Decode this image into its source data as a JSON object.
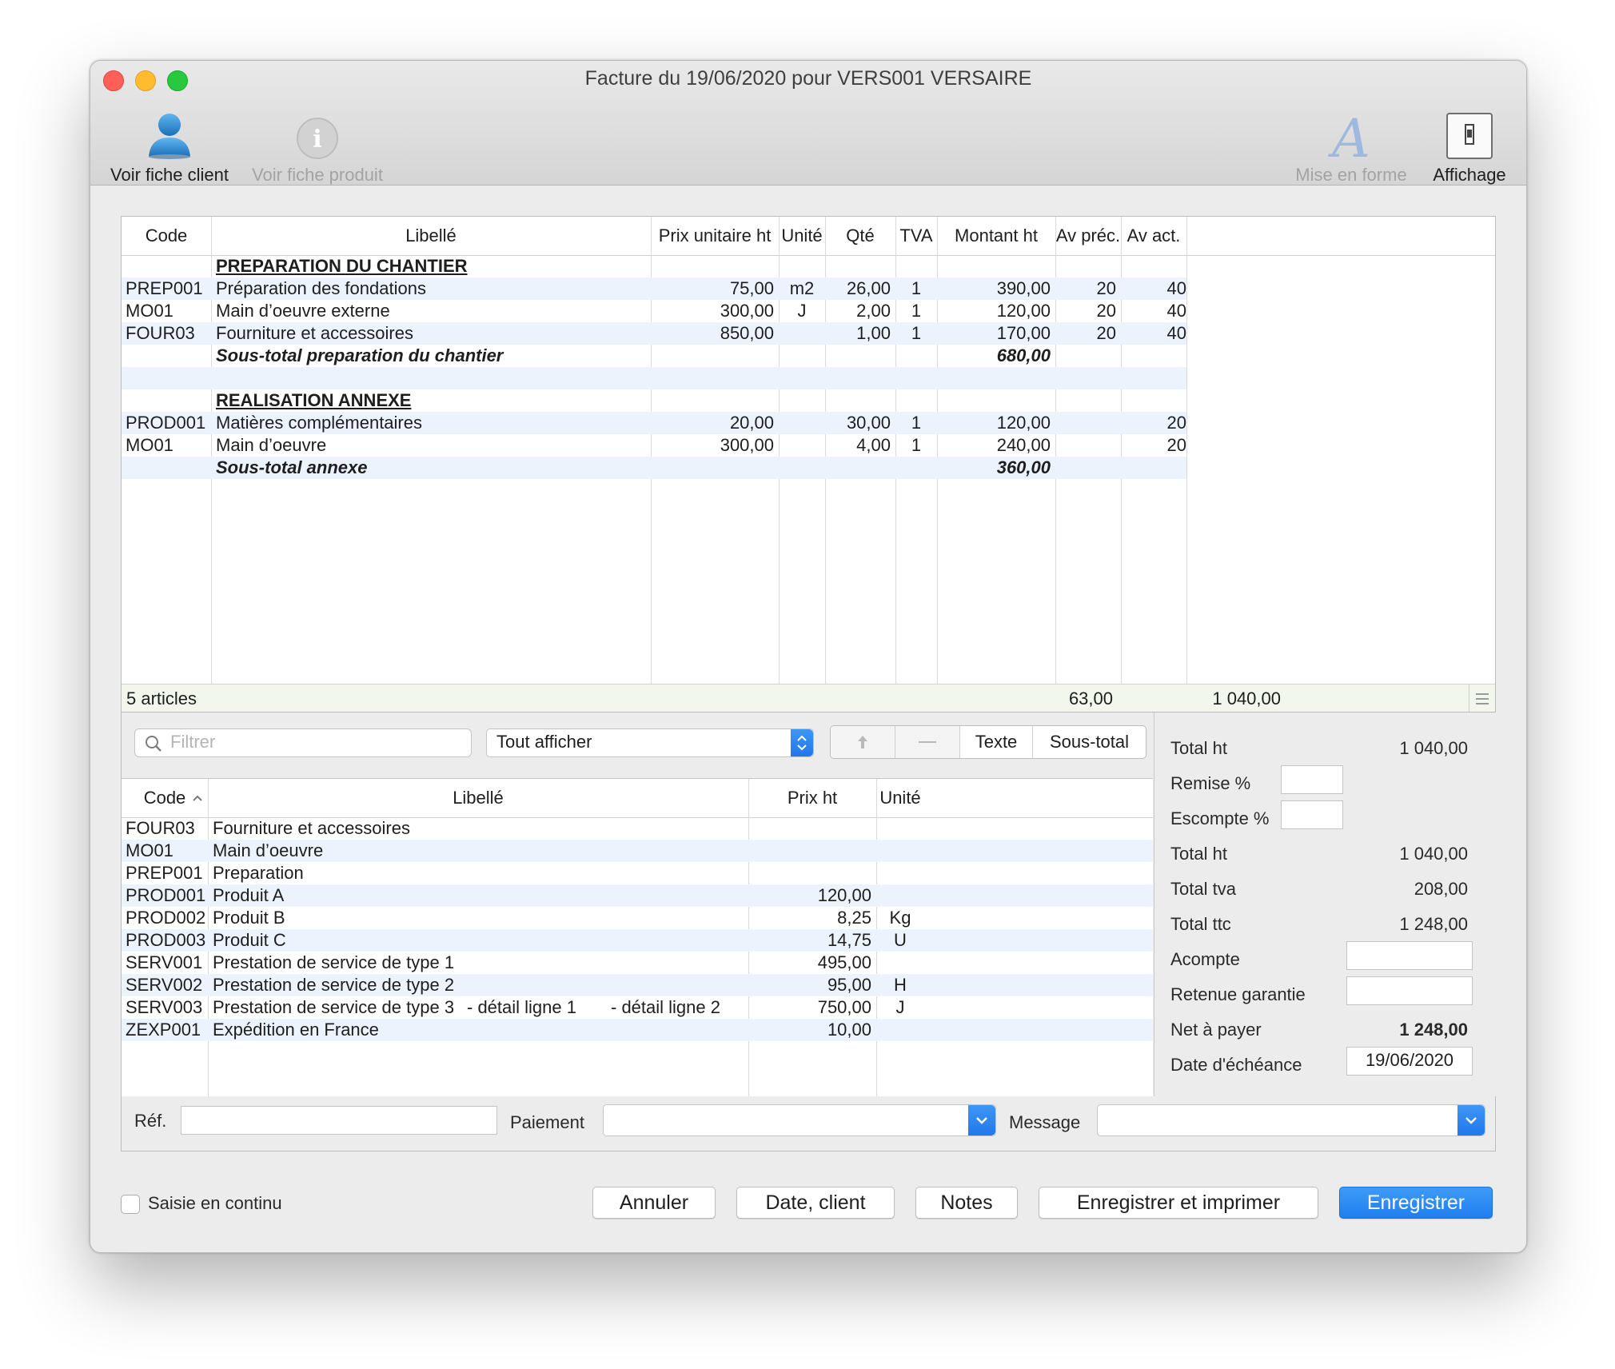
{
  "window": {
    "title": "Facture du 19/06/2020 pour VERS001 VERSAIRE"
  },
  "toolbar": {
    "customer": "Voir fiche client",
    "product": "Voir fiche produit",
    "format": "Mise en forme",
    "display": "Affichage"
  },
  "invoice": {
    "columns": [
      "Code",
      "Libellé",
      "Prix unitaire ht",
      "Unité",
      "Qté",
      "TVA",
      "Montant ht",
      "Av préc.",
      "Av act."
    ],
    "rows": [
      {
        "type": "section",
        "code": "",
        "label": "PREPARATION DU CHANTIER",
        "price": "",
        "unit": "",
        "qty": "",
        "tva": "",
        "amount": "",
        "prev": "",
        "act": ""
      },
      {
        "type": "item",
        "code": "PREP001",
        "label": "Préparation des fondations",
        "price": "75,00",
        "unit": "m2",
        "qty": "26,00",
        "tva": "1",
        "amount": "390,00",
        "prev": "20",
        "act": "40"
      },
      {
        "type": "item",
        "code": "MO01",
        "label": "Main d’oeuvre externe",
        "price": "300,00",
        "unit": "J",
        "qty": "2,00",
        "tva": "1",
        "amount": "120,00",
        "prev": "20",
        "act": "40"
      },
      {
        "type": "item",
        "code": "FOUR03",
        "label": "Fourniture et accessoires",
        "price": "850,00",
        "unit": "",
        "qty": "1,00",
        "tva": "1",
        "amount": "170,00",
        "prev": "20",
        "act": "40"
      },
      {
        "type": "subtotal",
        "code": "",
        "label": "Sous-total preparation du chantier",
        "price": "",
        "unit": "",
        "qty": "",
        "tva": "",
        "amount": "680,00",
        "prev": "",
        "act": ""
      },
      {
        "type": "blank",
        "code": "",
        "label": "",
        "price": "",
        "unit": "",
        "qty": "",
        "tva": "",
        "amount": "",
        "prev": "",
        "act": ""
      },
      {
        "type": "section",
        "code": "",
        "label": "REALISATION ANNEXE",
        "price": "",
        "unit": "",
        "qty": "",
        "tva": "",
        "amount": "",
        "prev": "",
        "act": ""
      },
      {
        "type": "item",
        "code": "PROD001",
        "label": "Matières complémentaires",
        "price": "20,00",
        "unit": "",
        "qty": "30,00",
        "tva": "1",
        "amount": "120,00",
        "prev": "",
        "act": "20"
      },
      {
        "type": "item",
        "code": "MO01",
        "label": "Main d’oeuvre",
        "price": "300,00",
        "unit": "",
        "qty": "4,00",
        "tva": "1",
        "amount": "240,00",
        "prev": "",
        "act": "20"
      },
      {
        "type": "subtotal",
        "code": "",
        "label": "Sous-total annexe",
        "price": "",
        "unit": "",
        "qty": "",
        "tva": "",
        "amount": "360,00",
        "prev": "",
        "act": ""
      }
    ],
    "footer": {
      "count": "5 articles",
      "qty": "63,00",
      "amount": "1 040,00"
    }
  },
  "catalog": {
    "filter_placeholder": "Filtrer",
    "select_value": "Tout afficher",
    "btn_text": "Texte",
    "btn_subtotal": "Sous-total",
    "columns": [
      "Code",
      "Libellé",
      "Prix ht",
      "Unité"
    ],
    "rows": [
      {
        "code": "FOUR03",
        "label": "Fourniture et accessoires",
        "extra1": "",
        "extra2": "",
        "price": "",
        "unit": ""
      },
      {
        "code": "MO01",
        "label": "Main d’oeuvre",
        "extra1": "",
        "extra2": "",
        "price": "",
        "unit": ""
      },
      {
        "code": "PREP001",
        "label": "Preparation",
        "extra1": "",
        "extra2": "",
        "price": "",
        "unit": ""
      },
      {
        "code": "PROD001",
        "label": "Produit A",
        "extra1": "",
        "extra2": "",
        "price": "120,00",
        "unit": ""
      },
      {
        "code": "PROD002",
        "label": "Produit B",
        "extra1": "",
        "extra2": "",
        "price": "8,25",
        "unit": "Kg"
      },
      {
        "code": "PROD003",
        "label": "Produit C",
        "extra1": "",
        "extra2": "",
        "price": "14,75",
        "unit": "U"
      },
      {
        "code": "SERV001",
        "label": "Prestation de service de type 1",
        "extra1": "",
        "extra2": "",
        "price": "495,00",
        "unit": ""
      },
      {
        "code": "SERV002",
        "label": "Prestation de service de type 2",
        "extra1": "",
        "extra2": "",
        "price": "95,00",
        "unit": "H"
      },
      {
        "code": "SERV003",
        "label": "Prestation de service de type 3",
        "extra1": "- détail ligne 1",
        "extra2": "- détail ligne 2",
        "price": "750,00",
        "unit": "J"
      },
      {
        "code": "ZEXP001",
        "label": "Expédition en France",
        "extra1": "",
        "extra2": "",
        "price": "10,00",
        "unit": ""
      }
    ]
  },
  "totals": {
    "total_ht_label": "Total ht",
    "total_ht": "1 040,00",
    "remise_label": "Remise %",
    "escompte_label": "Escompte %",
    "total_ht2_label": "Total ht",
    "total_ht2": "1 040,00",
    "total_tva_label": "Total tva",
    "total_tva": "208,00",
    "total_ttc_label": "Total ttc",
    "total_ttc": "1 248,00",
    "acompte_label": "Acompte",
    "retenue_label": "Retenue garantie",
    "net_label": "Net à payer",
    "net": "1 248,00",
    "due_label": "Date d'échéance",
    "due": "19/06/2020"
  },
  "bottom": {
    "ref_label": "Réf.",
    "payment_label": "Paiement",
    "message_label": "Message"
  },
  "footer": {
    "continuous": "Saisie en continu",
    "cancel": "Annuler",
    "date_client": "Date, client",
    "notes": "Notes",
    "save_print": "Enregistrer et imprimer",
    "save": "Enregistrer"
  },
  "colors": {
    "accent": "#1f7ef0",
    "stripe": "#edf3fd",
    "footer_row": "#f1f7ec"
  }
}
